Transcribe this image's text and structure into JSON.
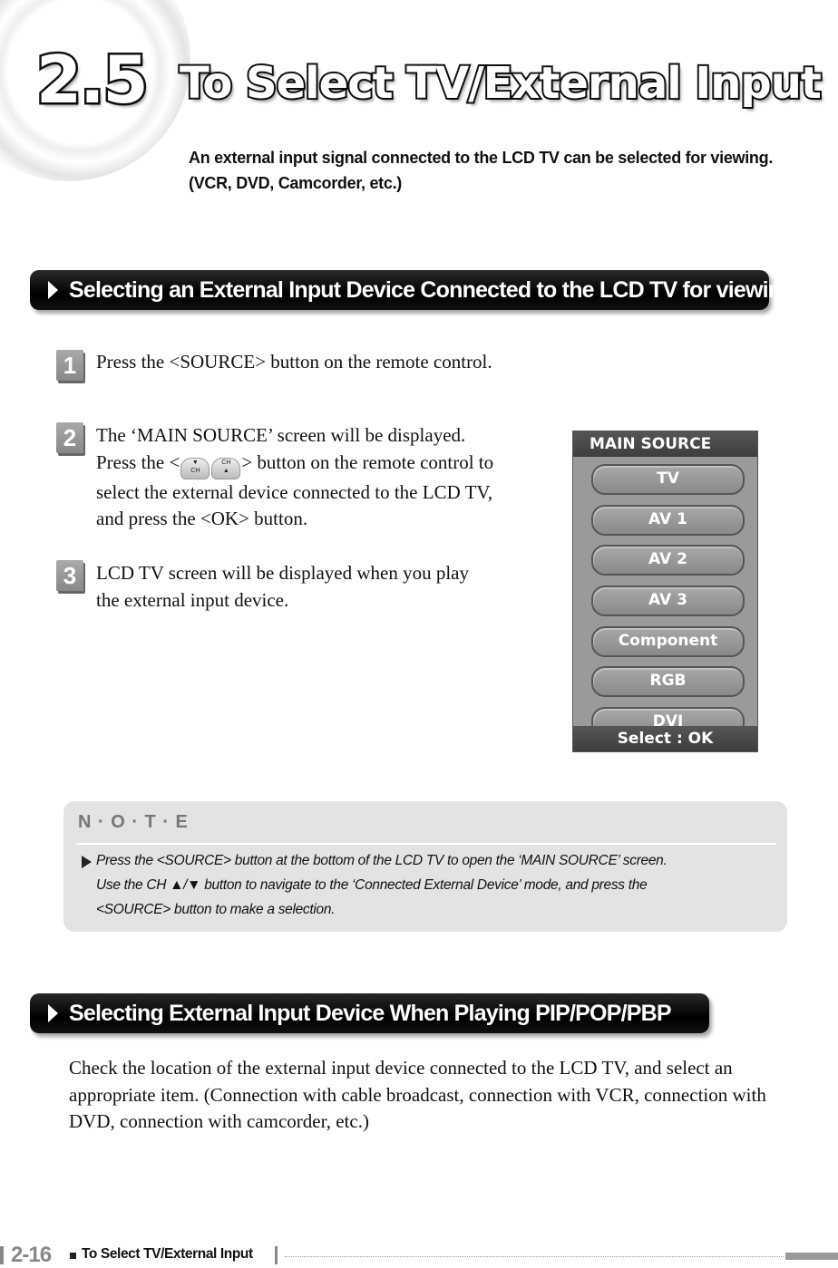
{
  "header": {
    "chapter_number": "2.5",
    "title": "To Select TV/External Input",
    "subtitle_line1": "An external input signal connected to the LCD TV can be selected for viewing.",
    "subtitle_line2": "(VCR, DVD, Camcorder, etc.)"
  },
  "section1": {
    "title": "Selecting an External Input Device Connected to the LCD TV for viewing",
    "steps": [
      {
        "number": "1",
        "lines": [
          "Press the <SOURCE> button on the remote control."
        ]
      },
      {
        "number": "2",
        "lines": [
          "The ‘MAIN SOURCE’ screen will be displayed.",
          "Press the <",
          "> button on the remote control to",
          "select the external device connected to the LCD TV,",
          "and press the <OK> button."
        ]
      },
      {
        "number": "3",
        "lines": [
          "LCD TV screen will be displayed when you play",
          "the external input device."
        ]
      }
    ],
    "ch_buttons": {
      "down_label": "CH",
      "up_label": "CH",
      "down_arrow": "▼",
      "up_arrow": "▲"
    }
  },
  "osd": {
    "header": "MAIN SOURCE",
    "items": [
      "TV",
      "AV 1",
      "AV 2",
      "AV 3",
      "Component",
      "RGB",
      "DVI"
    ],
    "footer": "Select : OK"
  },
  "note": {
    "title": "N · O · T · E",
    "lines": [
      "Press the <SOURCE> button at the bottom of the LCD TV to open the  ‘MAIN SOURCE’  screen.",
      "Use the CH ▲/▼ button to navigate to the ‘Connected External Device’  mode, and press the",
      "<SOURCE> button to make a selection."
    ]
  },
  "section2": {
    "title": "Selecting External Input Device When Playing PIP/POP/PBP",
    "paragraph_lines": [
      "Check the location of the external input device connected to the LCD TV, and select an",
      "appropriate item. (Connection with cable broadcast, connection with VCR, connection with",
      "DVD, connection with camcorder, etc.)"
    ]
  },
  "footer": {
    "page_number": "2-16",
    "title": "To Select TV/External Input"
  }
}
